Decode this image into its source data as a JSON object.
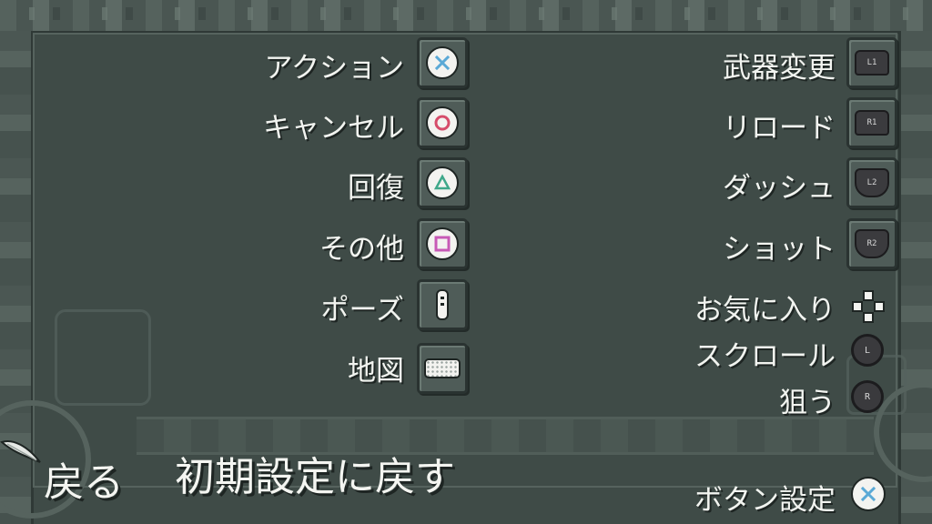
{
  "left_column": [
    {
      "label": "アクション",
      "button": "cross-button"
    },
    {
      "label": "キャンセル",
      "button": "circle-button"
    },
    {
      "label": "回復",
      "button": "triangle-button"
    },
    {
      "label": "その他",
      "button": "square-button"
    },
    {
      "label": "ポーズ",
      "button": "options-button"
    },
    {
      "label": "地図",
      "button": "touchpad-button"
    }
  ],
  "right_column": [
    {
      "label": "武器変更",
      "button": "L1",
      "button_text": "L1"
    },
    {
      "label": "リロード",
      "button": "R1",
      "button_text": "R1"
    },
    {
      "label": "ダッシュ",
      "button": "L2",
      "button_text": "L2"
    },
    {
      "label": "ショット",
      "button": "R2",
      "button_text": "R2"
    },
    {
      "label": "お気に入り",
      "button": "dpad"
    },
    {
      "label": "スクロール",
      "button": "L-stick",
      "button_text": "L"
    },
    {
      "label": "狙う",
      "button": "R-stick",
      "button_text": "R"
    }
  ],
  "footer": {
    "back_label": "戻る",
    "reset_label": "初期設定に戻す",
    "button_config_label": "ボタン設定"
  },
  "colors": {
    "background": "#3f4b47",
    "frame": "#56635e",
    "text": "#f2f4f0",
    "cross": "#5aa9d6",
    "circle": "#d64c6a",
    "triangle": "#3fa88a",
    "square": "#c75ab6"
  }
}
